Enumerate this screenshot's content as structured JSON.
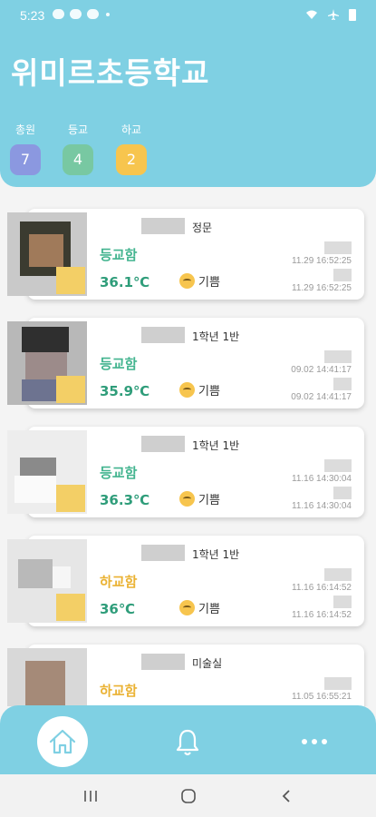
{
  "status_bar": {
    "time": "5:23"
  },
  "header": {
    "school_name": "위미르초등학교"
  },
  "stats": [
    {
      "label": "총원",
      "count": "7",
      "color": "#8b98e0"
    },
    {
      "label": "등교",
      "count": "4",
      "color": "#78c8a2"
    },
    {
      "label": "하교",
      "count": "2",
      "color": "#f7c54e"
    }
  ],
  "students": [
    {
      "class_label": "정문",
      "state": "등교함",
      "temp": "36.1℃",
      "mood": "기쁨",
      "time1": "11.29 16:52:25",
      "time2": "11.29 16:52:25"
    },
    {
      "class_label": "1학년 1반",
      "state": "등교함",
      "temp": "35.9℃",
      "mood": "기쁨",
      "time1": "09.02 14:41:17",
      "time2": "09.02 14:41:17"
    },
    {
      "class_label": "1학년 1반",
      "state": "등교함",
      "temp": "36.3℃",
      "mood": "기쁨",
      "time1": "11.16 14:30:04",
      "time2": "11.16 14:30:04"
    },
    {
      "class_label": "1학년 1반",
      "state": "하교함",
      "temp": "36℃",
      "mood": "기쁨",
      "time1": "11.16 16:14:52",
      "time2": "11.16 16:14:52"
    },
    {
      "class_label": "미술실",
      "state": "하교함",
      "temp": "",
      "mood": "",
      "time1": "11.05 16:55:21",
      "time2": ""
    }
  ],
  "nav": {
    "items": [
      "home-icon",
      "bell-icon",
      "more-icon"
    ]
  },
  "colors": {
    "primary": "#7fd0e3",
    "in": "#43b48f",
    "out": "#eab233"
  }
}
